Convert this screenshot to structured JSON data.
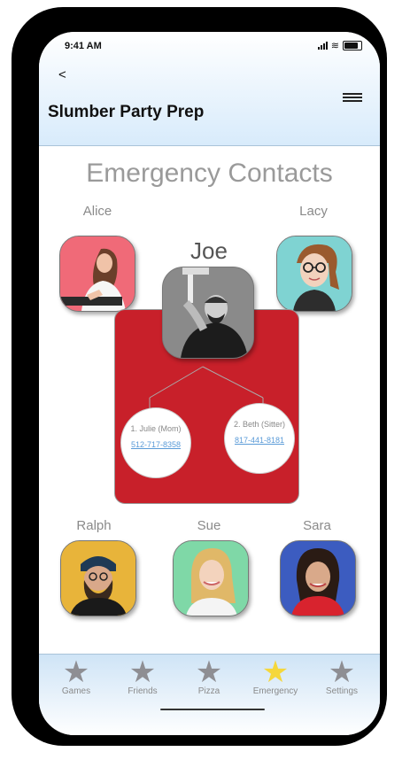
{
  "status": {
    "time": "9:41 AM"
  },
  "header": {
    "back_label": "<",
    "title": "Slumber Party Prep"
  },
  "page": {
    "section_title": "Emergency Contacts"
  },
  "contacts": {
    "alice": "Alice",
    "lacy": "Lacy",
    "joe": "Joe",
    "ralph": "Ralph",
    "sue": "Sue",
    "sara": "Sara"
  },
  "joe_contacts": [
    {
      "label": "1. Julie (Mom)",
      "phone": "512-717-8358"
    },
    {
      "label": "2. Beth (Sitter)",
      "phone": "817-441-8181"
    }
  ],
  "tabs": [
    {
      "label": "Games",
      "icon": "star-icon",
      "active": false
    },
    {
      "label": "Friends",
      "icon": "star-icon",
      "active": false
    },
    {
      "label": "Pizza",
      "icon": "star-icon",
      "active": false
    },
    {
      "label": "Emergency",
      "icon": "star-icon",
      "active": true
    },
    {
      "label": "Settings",
      "icon": "star-icon",
      "active": false
    }
  ],
  "colors": {
    "card": "#c8202a",
    "active_tab": "#f5d73b",
    "inactive_tab": "#8e8e93",
    "link": "#5a9bd8"
  }
}
